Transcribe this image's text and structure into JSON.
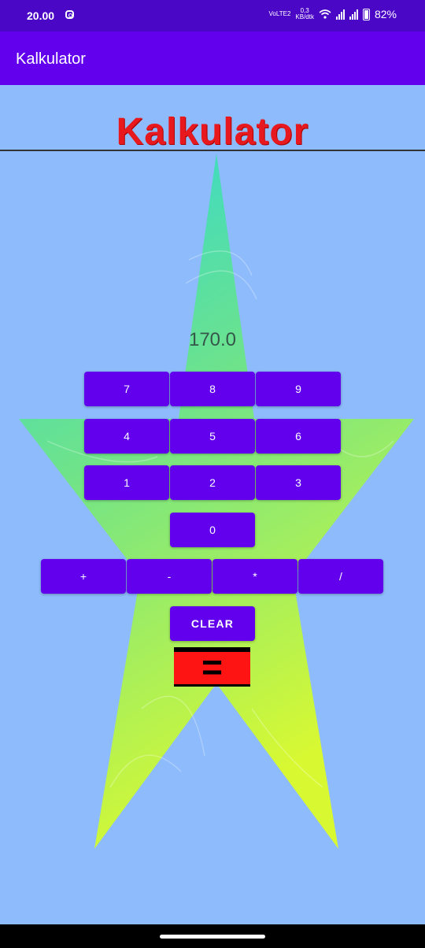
{
  "status_bar": {
    "time": "20.00",
    "volte": "VoLTE2",
    "net_speed_value": "0,3",
    "net_speed_unit": "KB/dtk",
    "battery_pct": "82%"
  },
  "app_bar": {
    "title": "Kalkulator"
  },
  "header": {
    "title": "Kalkulator"
  },
  "calculator": {
    "display": "170.0",
    "keys": {
      "k7": "7",
      "k8": "8",
      "k9": "9",
      "k4": "4",
      "k5": "5",
      "k6": "6",
      "k1": "1",
      "k2": "2",
      "k3": "3",
      "k0": "0"
    },
    "ops": {
      "add": "+",
      "sub": "-",
      "mul": "*",
      "div": "/"
    },
    "clear": "CLEAR",
    "equals": "="
  },
  "colors": {
    "background": "#8DBBFB",
    "accent": "#6200EE",
    "title_red": "#E8191E",
    "equals_red": "#FF1414"
  }
}
